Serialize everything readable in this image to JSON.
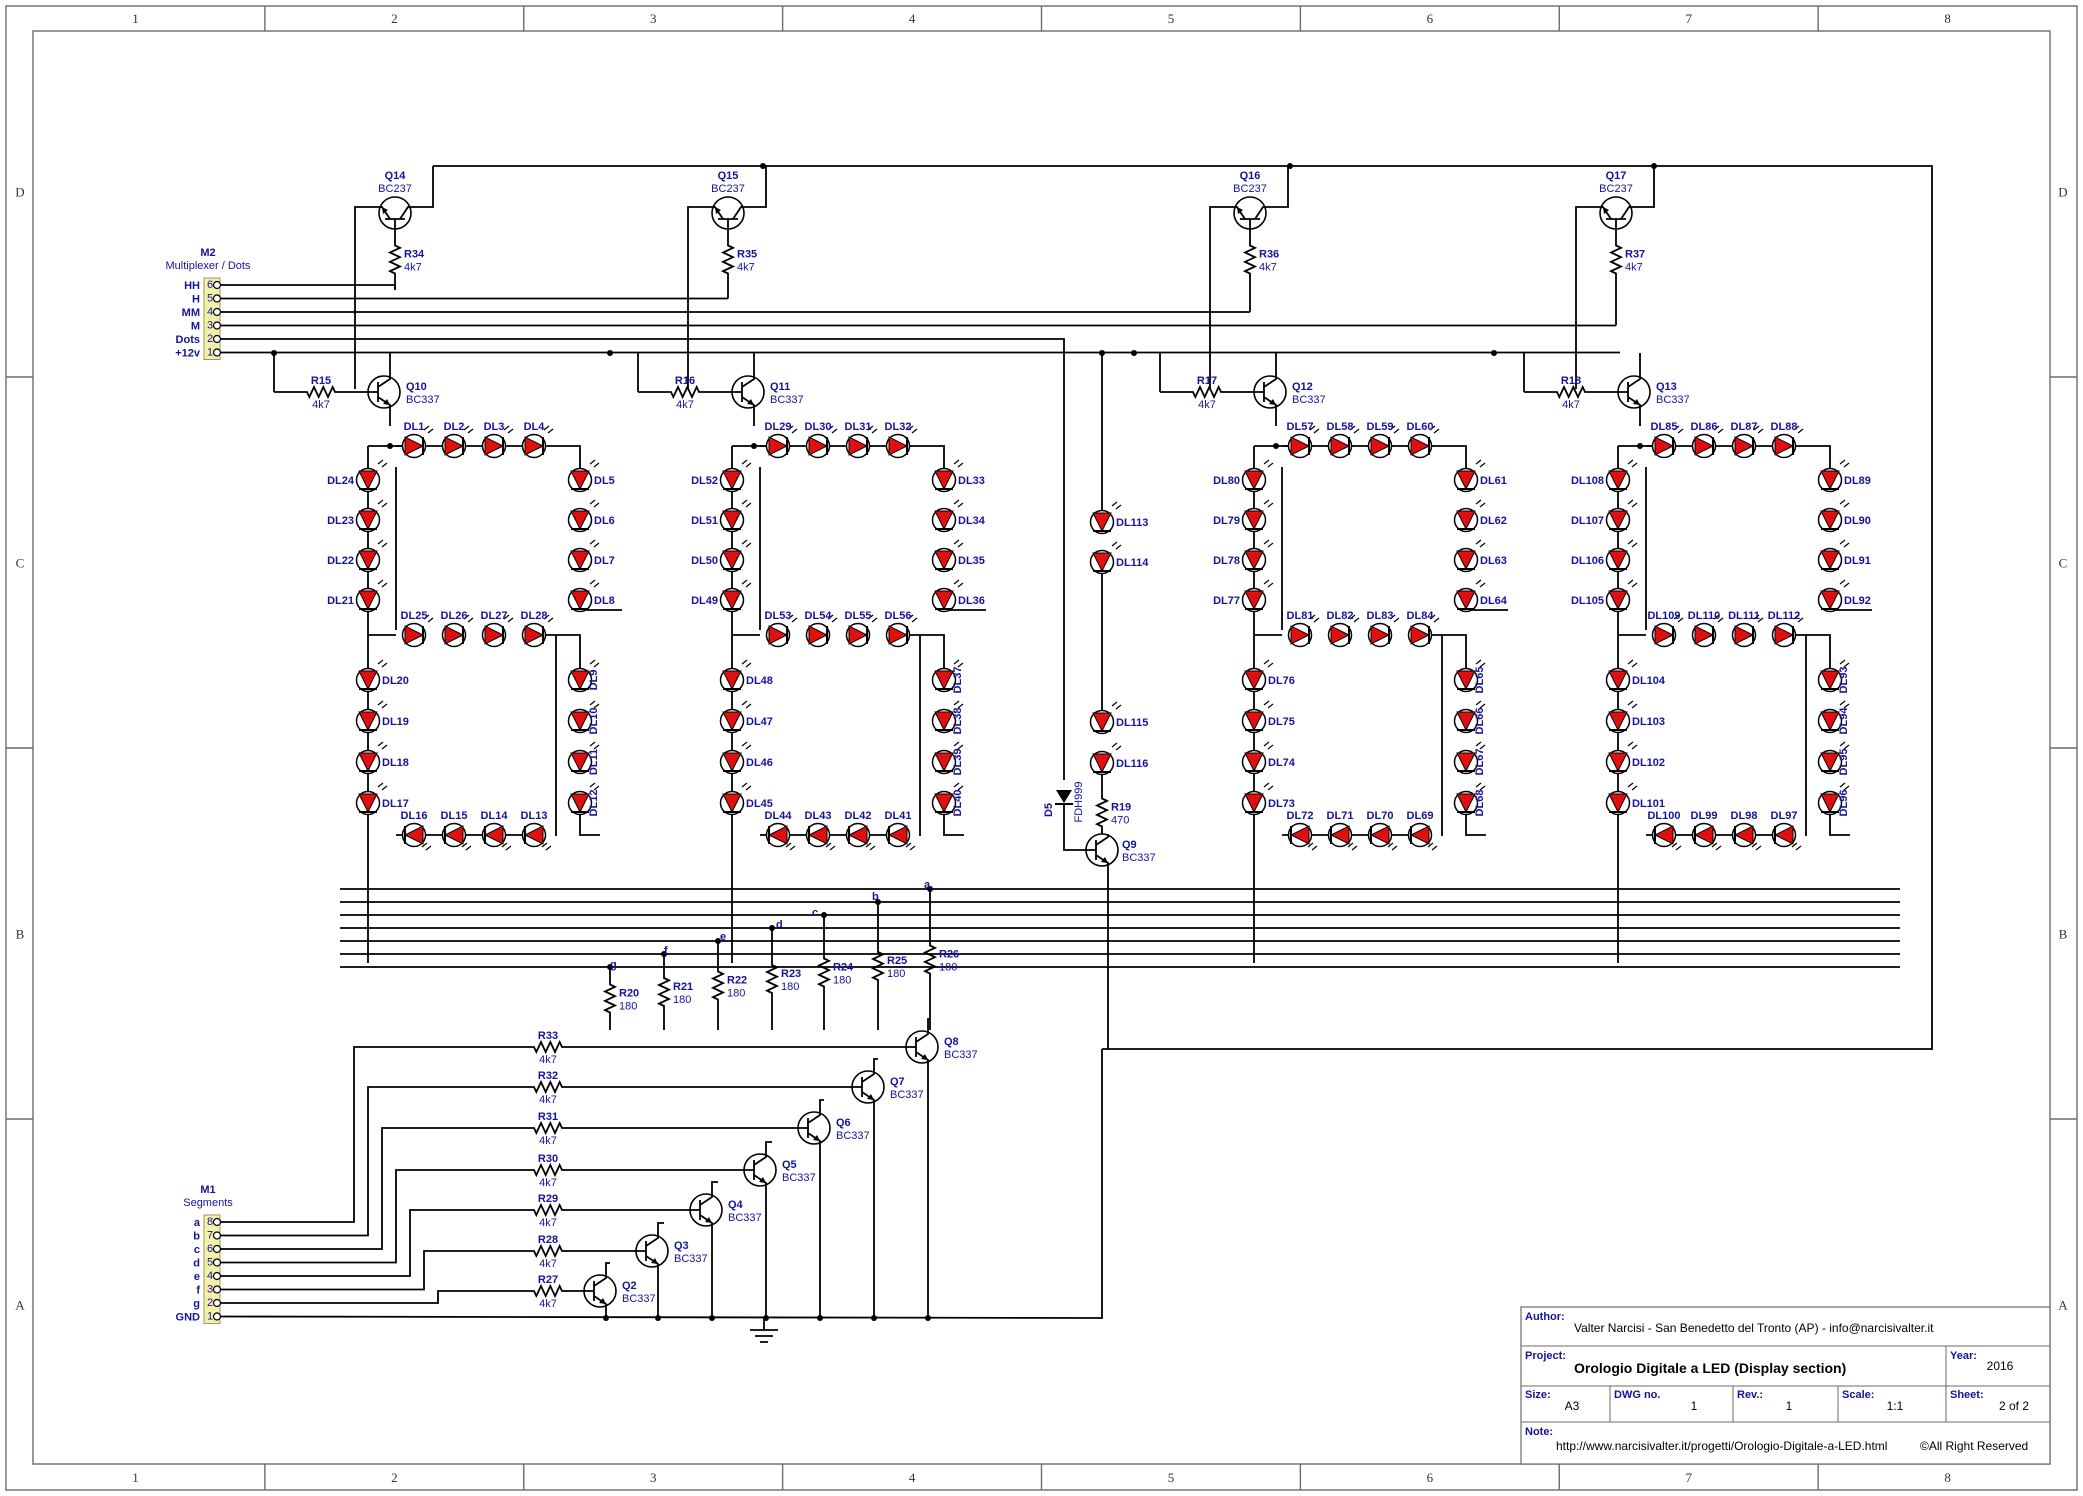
{
  "frame": {
    "columns": [
      "1",
      "2",
      "3",
      "4",
      "5",
      "6",
      "7",
      "8"
    ],
    "rows": [
      "D",
      "C",
      "B",
      "A"
    ]
  },
  "connectors": {
    "m2": {
      "ref": "M2",
      "name": "Multiplexer / Dots",
      "pins": [
        {
          "label": "HH",
          "num": "6"
        },
        {
          "label": "H",
          "num": "5"
        },
        {
          "label": "MM",
          "num": "4"
        },
        {
          "label": "M",
          "num": "3"
        },
        {
          "label": "Dots",
          "num": "2"
        },
        {
          "label": "+12v",
          "num": "1"
        }
      ]
    },
    "m1": {
      "ref": "M1",
      "name": "Segments",
      "pins": [
        {
          "label": "a",
          "num": "8"
        },
        {
          "label": "b",
          "num": "7"
        },
        {
          "label": "c",
          "num": "6"
        },
        {
          "label": "d",
          "num": "5"
        },
        {
          "label": "e",
          "num": "4"
        },
        {
          "label": "f",
          "num": "3"
        },
        {
          "label": "g",
          "num": "2"
        },
        {
          "label": "GND",
          "num": "1"
        }
      ]
    }
  },
  "pnp": [
    {
      "ref": "Q14",
      "type": "BC237",
      "r_ref": "R34",
      "r_val": "4k7"
    },
    {
      "ref": "Q15",
      "type": "BC237",
      "r_ref": "R35",
      "r_val": "4k7"
    },
    {
      "ref": "Q16",
      "type": "BC237",
      "r_ref": "R36",
      "r_val": "4k7"
    },
    {
      "ref": "Q17",
      "type": "BC237",
      "r_ref": "R37",
      "r_val": "4k7"
    }
  ],
  "digit_drivers": [
    {
      "ref": "Q10",
      "type": "BC337",
      "r_ref": "R15",
      "r_val": "4k7"
    },
    {
      "ref": "Q11",
      "type": "BC337",
      "r_ref": "R16",
      "r_val": "4k7"
    },
    {
      "ref": "Q12",
      "type": "BC337",
      "r_ref": "R17",
      "r_val": "4k7"
    },
    {
      "ref": "Q13",
      "type": "BC337",
      "r_ref": "R18",
      "r_val": "4k7"
    }
  ],
  "digits": [
    {
      "top": [
        "DL1",
        "DL2",
        "DL3",
        "DL4"
      ],
      "left_upper": [
        "DL24",
        "DL23",
        "DL22",
        "DL21"
      ],
      "right_upper": [
        "DL5",
        "DL6",
        "DL7",
        "DL8"
      ],
      "middle": [
        "DL25",
        "DL26",
        "DL27",
        "DL28"
      ],
      "left_lower": [
        "DL20",
        "DL19",
        "DL18",
        "DL17"
      ],
      "right_lower": [
        "DL9",
        "DL10",
        "DL11",
        "DL12"
      ],
      "bottom": [
        "DL16",
        "DL15",
        "DL14",
        "DL13"
      ]
    },
    {
      "top": [
        "DL29",
        "DL30",
        "DL31",
        "DL32"
      ],
      "left_upper": [
        "DL52",
        "DL51",
        "DL50",
        "DL49"
      ],
      "right_upper": [
        "DL33",
        "DL34",
        "DL35",
        "DL36"
      ],
      "middle": [
        "DL53",
        "DL54",
        "DL55",
        "DL56"
      ],
      "left_lower": [
        "DL48",
        "DL47",
        "DL46",
        "DL45"
      ],
      "right_lower": [
        "DL37",
        "DL38",
        "DL39",
        "DL40"
      ],
      "bottom": [
        "DL44",
        "DL43",
        "DL42",
        "DL41"
      ]
    },
    {
      "top": [
        "DL57",
        "DL58",
        "DL59",
        "DL60"
      ],
      "left_upper": [
        "DL80",
        "DL79",
        "DL78",
        "DL77"
      ],
      "right_upper": [
        "DL61",
        "DL62",
        "DL63",
        "DL64"
      ],
      "middle": [
        "DL81",
        "DL82",
        "DL83",
        "DL84"
      ],
      "left_lower": [
        "DL76",
        "DL75",
        "DL74",
        "DL73"
      ],
      "right_lower": [
        "DL65",
        "DL66",
        "DL67",
        "DL68"
      ],
      "bottom": [
        "DL72",
        "DL71",
        "DL70",
        "DL69"
      ]
    },
    {
      "top": [
        "DL85",
        "DL86",
        "DL87",
        "DL88"
      ],
      "left_upper": [
        "DL108",
        "DL107",
        "DL106",
        "DL105"
      ],
      "right_upper": [
        "DL89",
        "DL90",
        "DL91",
        "DL92"
      ],
      "middle": [
        "DL109",
        "DL110",
        "DL111",
        "DL112"
      ],
      "left_lower": [
        "DL104",
        "DL103",
        "DL102",
        "DL101"
      ],
      "right_lower": [
        "DL93",
        "DL94",
        "DL95",
        "DL96"
      ],
      "bottom": [
        "DL100",
        "DL99",
        "DL98",
        "DL97"
      ]
    }
  ],
  "dots": {
    "leds": [
      "DL113",
      "DL114",
      "DL115",
      "DL116"
    ],
    "diode_ref": "D5",
    "diode_type": "FDH999",
    "r_ref": "R19",
    "r_val": "470",
    "q_ref": "Q9",
    "q_type": "BC337"
  },
  "bus_labels": [
    "a",
    "b",
    "c",
    "d",
    "e",
    "f",
    "g"
  ],
  "segment_resistors": [
    {
      "ref": "R20",
      "val": "180"
    },
    {
      "ref": "R21",
      "val": "180"
    },
    {
      "ref": "R22",
      "val": "180"
    },
    {
      "ref": "R23",
      "val": "180"
    },
    {
      "ref": "R24",
      "val": "180"
    },
    {
      "ref": "R25",
      "val": "180"
    },
    {
      "ref": "R26",
      "val": "180"
    }
  ],
  "segment_drivers": [
    {
      "q_ref": "Q8",
      "q_type": "BC337",
      "r_ref": "R33",
      "r_val": "4k7"
    },
    {
      "q_ref": "Q7",
      "q_type": "BC337",
      "r_ref": "R32",
      "r_val": "4k7"
    },
    {
      "q_ref": "Q6",
      "q_type": "BC337",
      "r_ref": "R31",
      "r_val": "4k7"
    },
    {
      "q_ref": "Q5",
      "q_type": "BC337",
      "r_ref": "R30",
      "r_val": "4k7"
    },
    {
      "q_ref": "Q4",
      "q_type": "BC337",
      "r_ref": "R29",
      "r_val": "4k7"
    },
    {
      "q_ref": "Q3",
      "q_type": "BC337",
      "r_ref": "R28",
      "r_val": "4k7"
    },
    {
      "q_ref": "Q2",
      "q_type": "BC337",
      "r_ref": "R27",
      "r_val": "4k7"
    }
  ],
  "title_block": {
    "author_label": "Author:",
    "author": "Valter Narcisi - San Benedetto del Tronto (AP) - info@narcisivalter.it",
    "project_label": "Project:",
    "project": "Orologio Digitale a LED (Display section)",
    "year_label": "Year:",
    "year": "2016",
    "size_label": "Size:",
    "size": "A3",
    "dwg_label": "DWG no.",
    "dwg": "1",
    "rev_label": "Rev.:",
    "rev": "1",
    "scale_label": "Scale:",
    "scale": "1:1",
    "sheet_label": "Sheet:",
    "sheet": "2 of 2",
    "note_label": "Note:",
    "note": "http://www.narcisivalter.it/progetti/Orologio-Digitale-a-LED.html",
    "rights": "©All Right Reserved"
  },
  "colors": {
    "wire": "#000000",
    "label": "#14149a",
    "led_fill": "#e01010",
    "connector_fill": "#f4f0a8",
    "frame": "#6b6b6b"
  }
}
